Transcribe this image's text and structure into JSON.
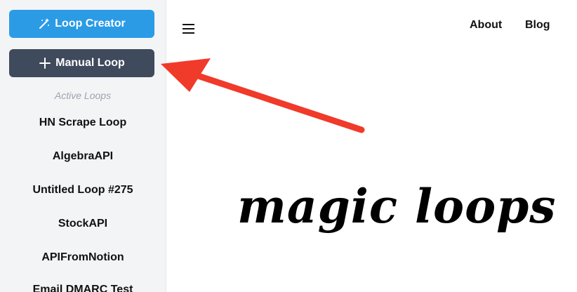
{
  "sidebar": {
    "loop_creator_label": "Loop Creator",
    "manual_loop_label": "Manual Loop",
    "section_label": "Active Loops",
    "loops": [
      "HN Scrape Loop",
      "AlgebraAPI",
      "Untitled Loop #275",
      "StockAPI",
      "APIFromNotion",
      "Email DMARC Test"
    ]
  },
  "nav": {
    "about": "About",
    "blog": "Blog"
  },
  "logo_text": "magic loops",
  "colors": {
    "primary": "#2b9be6",
    "secondary": "#3f4a5c",
    "annotation_arrow": "#f03a2a"
  },
  "icons": {
    "loop_creator": "magic-wand-icon",
    "manual_loop": "plus-icon",
    "menu": "hamburger-icon"
  }
}
